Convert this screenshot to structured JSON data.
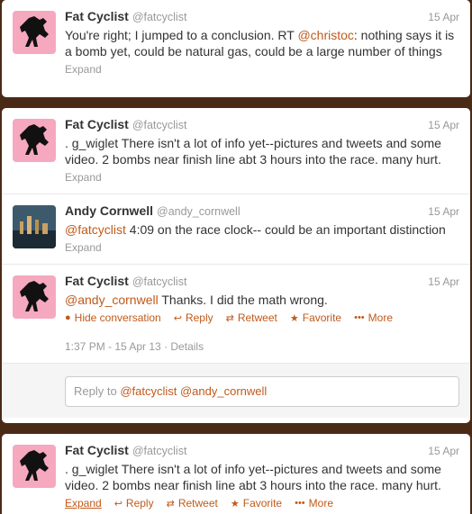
{
  "colors": {
    "background": "#4a2a16",
    "link": "#c05a1a",
    "avatar_pink": "#f6a8bf"
  },
  "tweets": [
    {
      "name": "Fat Cyclist",
      "handle": "@fatcyclist",
      "date": "15 Apr",
      "text_pre": "You're right; I jumped to a conclusion. RT ",
      "mention": "@christoc",
      "text_post": ": nothing says it is a bomb yet, could be natural gas, could be a large number of things",
      "expand": "Expand"
    },
    {
      "name": "Fat Cyclist",
      "handle": "@fatcyclist",
      "date": "15 Apr",
      "text": ". g_wiglet There isn't a lot of info yet--pictures and tweets and some video. 2 bombs near finish line abt 3 hours into the race. many hurt.",
      "expand": "Expand"
    },
    {
      "name": "Andy Cornwell",
      "handle": "@andy_cornwell",
      "date": "15 Apr",
      "mention": "@fatcyclist",
      "text_post": " 4:09 on the race clock-- could be an important distinction",
      "expand": "Expand"
    },
    {
      "name": "Fat Cyclist",
      "handle": "@fatcyclist",
      "date": "15 Apr",
      "mention": "@andy_cornwell",
      "text_post": " Thanks. I did the math wrong.",
      "actions": {
        "hide": "Hide conversation",
        "reply": "Reply",
        "retweet": "Retweet",
        "favorite": "Favorite",
        "more": "More"
      },
      "meta": "1:37 PM - 15 Apr 13 · Details"
    },
    {
      "name": "Fat Cyclist",
      "handle": "@fatcyclist",
      "date": "15 Apr",
      "text": ". g_wiglet There isn't a lot of info yet--pictures and tweets and some video. 2 bombs near finish line abt 3 hours into the race. many hurt.",
      "actions": {
        "expand": "Expand",
        "reply": "Reply",
        "retweet": "Retweet",
        "favorite": "Favorite",
        "more": "More"
      }
    }
  ],
  "reply_box": {
    "prefix": "Reply to ",
    "mention1": "@fatcyclist",
    "mention2": "@andy_cornwell"
  }
}
